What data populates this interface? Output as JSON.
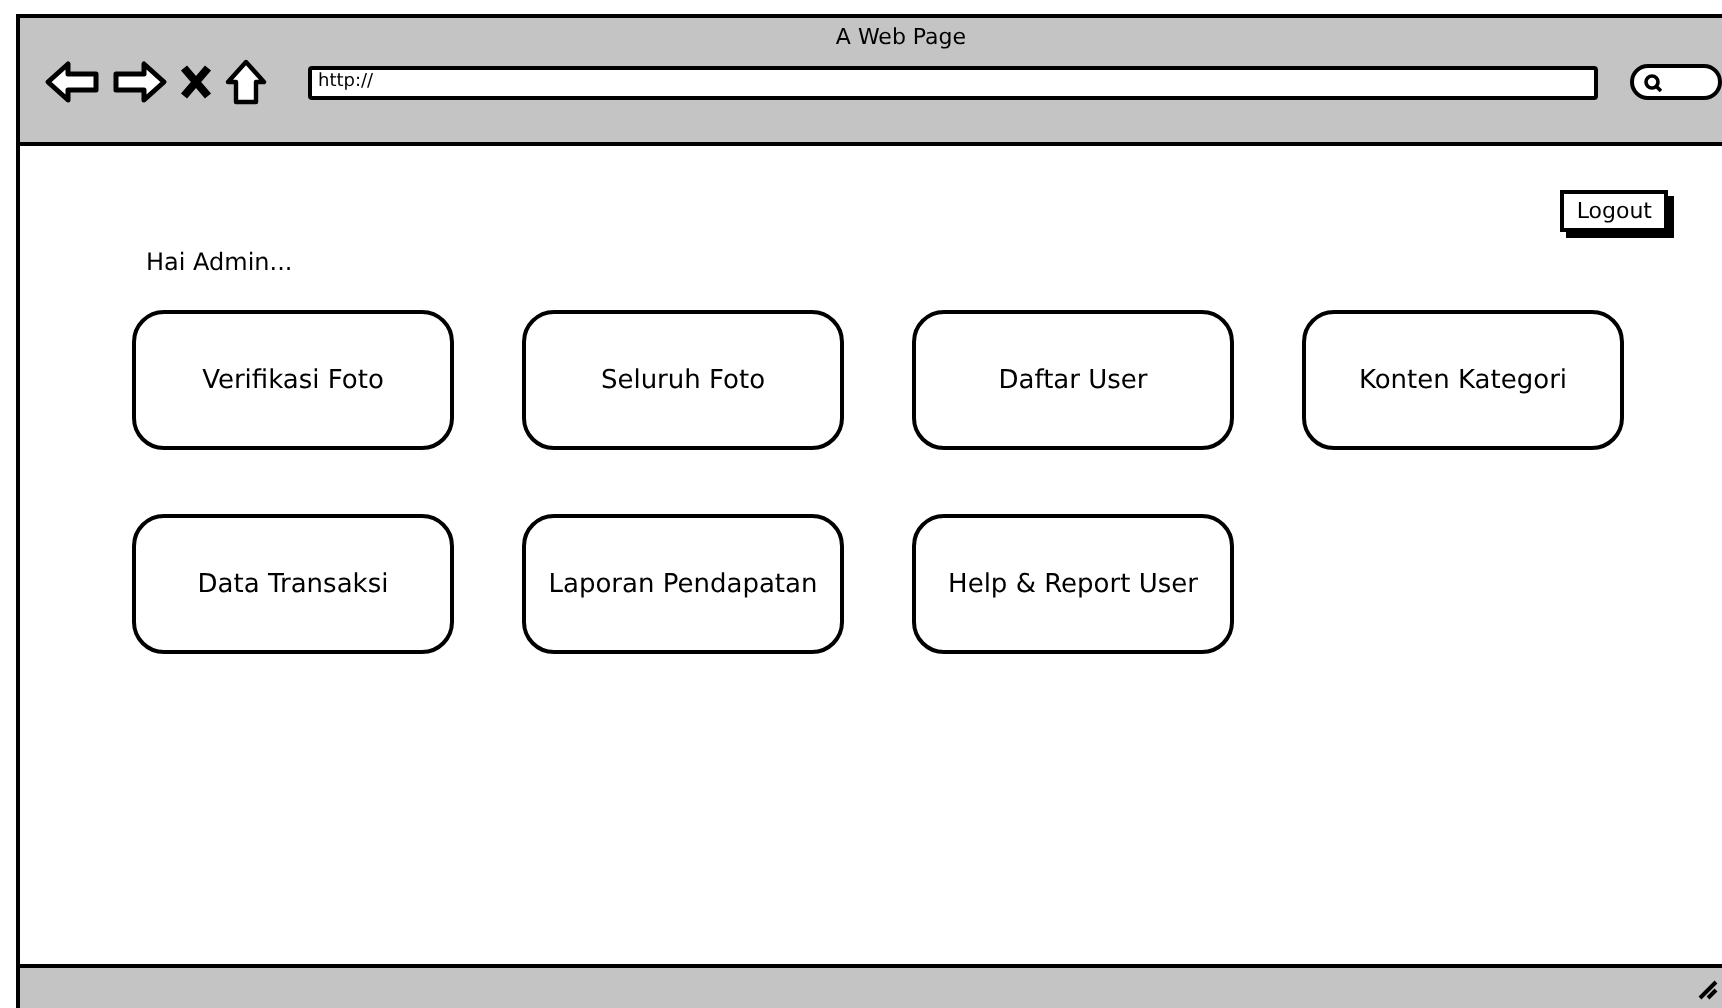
{
  "window": {
    "title": "A Web Page"
  },
  "browser": {
    "address": "http://"
  },
  "logout_button": "Logout",
  "greeting": "Hai Admin...",
  "menu_buttons": [
    {
      "label": "Verifikasi Foto"
    },
    {
      "label": "Seluruh Foto"
    },
    {
      "label": "Daftar User"
    },
    {
      "label": "Konten Kategori"
    },
    {
      "label": "Data Transaksi"
    },
    {
      "label": "Laporan Pendapatan"
    },
    {
      "label": "Help & Report User"
    }
  ]
}
